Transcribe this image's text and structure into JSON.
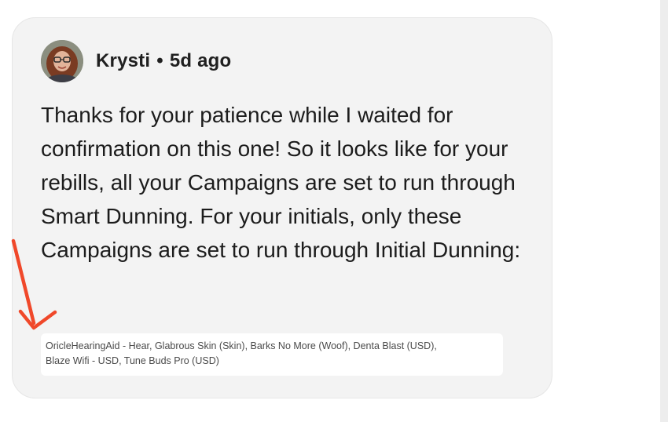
{
  "comment": {
    "author": "Krysti",
    "separator": "•",
    "time_ago": "5d ago",
    "body": "Thanks for your patience while I waited for confirmation on this one! So it looks like for your rebills, all your Campaigns are set to run through Smart Dunning. For your initials, only these Campaigns are set to run through Initial Dunning:"
  },
  "screenshot_snippet": {
    "line1": "OricleHearingAid - Hear, Glabrous Skin (Skin), Barks No More (Woof), Denta Blast (USD),",
    "line2": "Blaze Wifi - USD, Tune Buds Pro (USD)"
  },
  "annotation": {
    "arrow_color": "#f0482a"
  }
}
